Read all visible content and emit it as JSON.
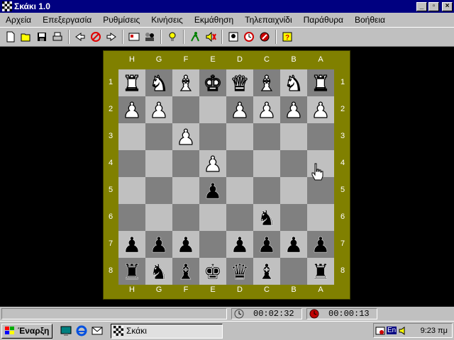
{
  "window": {
    "title": "Σκάκι 1.0"
  },
  "menu": [
    "Αρχεία",
    "Επεξεργασία",
    "Ρυθμίσεις",
    "Κινήσεις",
    "Εκμάθηση",
    "Τηλεπαιχνίδι",
    "Παράθυρα",
    "Βοήθεια"
  ],
  "toolbar": [
    "new-icon",
    "open-icon",
    "save-icon",
    "print-icon",
    "sep",
    "take-back-icon",
    "stop-icon",
    "forward-move-icon",
    "sep",
    "board-setup-icon",
    "players-icon",
    "sep",
    "hint-icon",
    "sep",
    "run-icon",
    "sound-icon",
    "sep",
    "pieces-setup-icon",
    "clock-icon",
    "clock-stop-icon",
    "sep",
    "help-icon"
  ],
  "board": {
    "files": [
      "H",
      "G",
      "F",
      "E",
      "D",
      "C",
      "B",
      "A"
    ],
    "ranks": [
      "1",
      "2",
      "3",
      "4",
      "5",
      "6",
      "7",
      "8"
    ],
    "rows": [
      [
        "wR",
        "wN",
        "wB",
        "wK",
        "wQ",
        "wB",
        "wN",
        "wR"
      ],
      [
        "wP",
        "wP",
        "",
        "",
        "wP",
        "wP",
        "wP",
        "wP"
      ],
      [
        "",
        "",
        "wP",
        "",
        "",
        "",
        "",
        ""
      ],
      [
        "",
        "",
        "",
        "wP",
        "",
        "",
        "",
        ""
      ],
      [
        "",
        "",
        "",
        "bP",
        "",
        "",
        "",
        ""
      ],
      [
        "",
        "",
        "",
        "",
        "",
        "bN",
        "",
        ""
      ],
      [
        "bP",
        "bP",
        "bP",
        "",
        "bP",
        "bP",
        "bP",
        "bP"
      ],
      [
        "bR",
        "bN",
        "bB",
        "bK",
        "bQ",
        "bB",
        "",
        "bR"
      ]
    ]
  },
  "status": {
    "message": "",
    "white_clock": "00:02:32",
    "black_clock": "00:00:13"
  },
  "taskbar": {
    "start_label": "Έναρξη",
    "task_label": "Σκάκι",
    "lang": "En",
    "time": "9:23 πμ"
  }
}
